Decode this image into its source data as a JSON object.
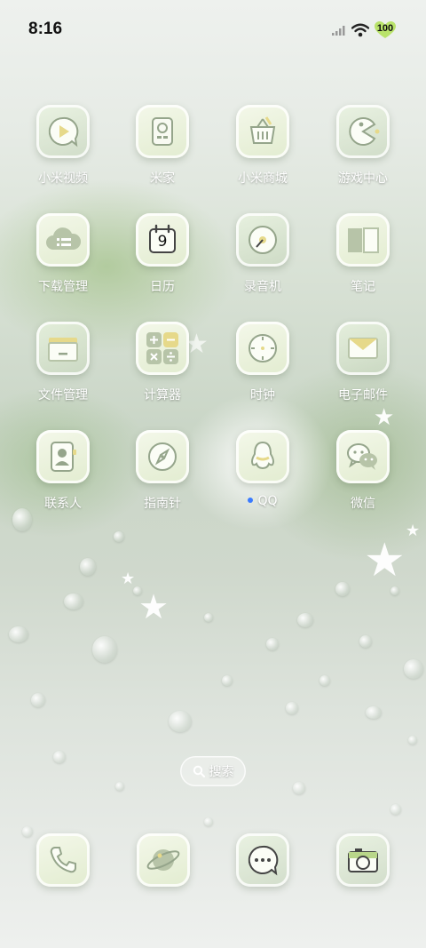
{
  "status_bar": {
    "time": "8:16",
    "battery": "100",
    "icons": [
      "signal-icon",
      "wifi-icon",
      "battery-icon"
    ]
  },
  "apps": [
    {
      "label": "小米视频",
      "icon": "video-play-icon"
    },
    {
      "label": "米家",
      "icon": "mijia-device-icon"
    },
    {
      "label": "小米商城",
      "icon": "shopping-basket-icon"
    },
    {
      "label": "游戏中心",
      "icon": "pacman-icon"
    },
    {
      "label": "下载管理",
      "icon": "cloud-download-icon"
    },
    {
      "label": "日历",
      "icon": "calendar-icon",
      "date": "9"
    },
    {
      "label": "录音机",
      "icon": "record-disc-icon"
    },
    {
      "label": "笔记",
      "icon": "notebook-icon"
    },
    {
      "label": "文件管理",
      "icon": "folder-icon"
    },
    {
      "label": "计算器",
      "icon": "calculator-icon"
    },
    {
      "label": "时钟",
      "icon": "clock-icon"
    },
    {
      "label": "电子邮件",
      "icon": "mail-icon"
    },
    {
      "label": "联系人",
      "icon": "contact-card-icon"
    },
    {
      "label": "指南针",
      "icon": "compass-icon"
    },
    {
      "label": "QQ",
      "icon": "qq-penguin-icon",
      "new_indicator": true
    },
    {
      "label": "微信",
      "icon": "wechat-icon"
    }
  ],
  "search": {
    "label": "搜索",
    "icon": "search-icon"
  },
  "dock": [
    {
      "icon": "phone-icon"
    },
    {
      "icon": "browser-planet-icon"
    },
    {
      "icon": "messages-icon"
    },
    {
      "icon": "camera-icon"
    }
  ],
  "colors": {
    "icon_tile": "#e2ecd0",
    "icon_stroke": "#8f9f86",
    "accent_yellow": "#e6d98a",
    "label_text": "#ffffff",
    "notification_dot": "#3a7bff"
  }
}
